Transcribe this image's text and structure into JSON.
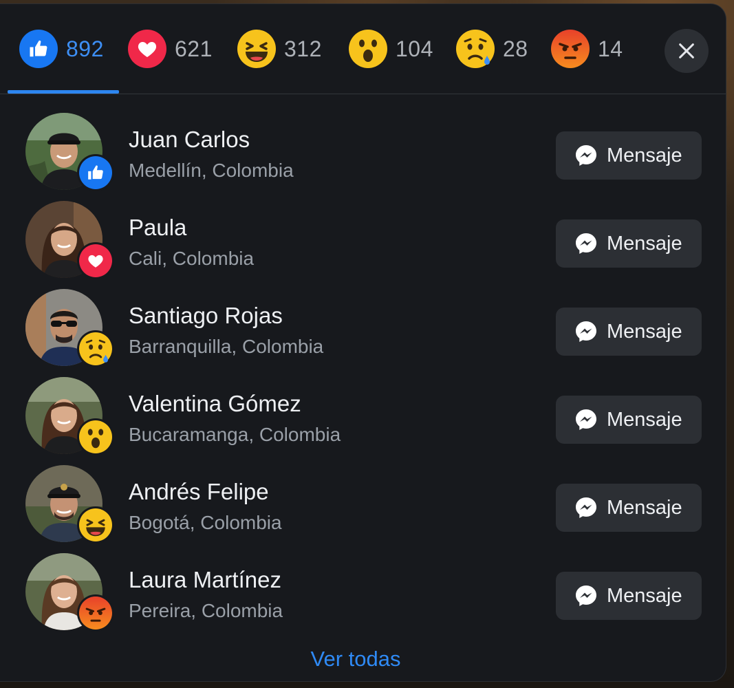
{
  "tabs": [
    {
      "reaction": "like",
      "count": "892",
      "icon": "like-icon",
      "color": "#1877f2"
    },
    {
      "reaction": "love",
      "count": "621",
      "icon": "heart-icon",
      "color": "#f02849"
    },
    {
      "reaction": "haha",
      "count": "312",
      "icon": "laughing-face-icon",
      "color": "#f7c31c"
    },
    {
      "reaction": "wow",
      "count": "104",
      "icon": "surprised-face-icon",
      "color": "#f7c31c"
    },
    {
      "reaction": "sad",
      "count": "28",
      "icon": "sad-face-icon",
      "color": "#f7c31c"
    },
    {
      "reaction": "angry",
      "count": "14",
      "icon": "angry-face-icon",
      "color": "#f15a24"
    }
  ],
  "active_tab": "like",
  "close_icon": "close-icon",
  "people": [
    {
      "name": "Juan Carlos",
      "location": "Medellín, Colombia",
      "reaction": "like",
      "avatar": "man-cap-avatar"
    },
    {
      "name": "Paula",
      "location": "Cali, Colombia",
      "reaction": "love",
      "avatar": "woman-avatar"
    },
    {
      "name": "Santiago Rojas",
      "location": "Barranquilla, Colombia",
      "reaction": "sad",
      "avatar": "man-sunglasses-avatar"
    },
    {
      "name": "Valentina Gómez",
      "location": "Bucaramanga, Colombia",
      "reaction": "wow",
      "avatar": "woman-avatar"
    },
    {
      "name": "Andrés Felipe",
      "location": "Bogotá, Colombia",
      "reaction": "haha",
      "avatar": "man-cap-avatar"
    },
    {
      "name": "Laura Martínez",
      "location": "Pereira, Colombia",
      "reaction": "angry",
      "avatar": "woman-avatar"
    }
  ],
  "message_button": {
    "label": "Mensaje",
    "icon": "messenger-icon"
  },
  "see_all": "Ver todas",
  "colors": {
    "accent": "#2d86f0",
    "panel": "#17191d",
    "button": "#2c2f34"
  }
}
